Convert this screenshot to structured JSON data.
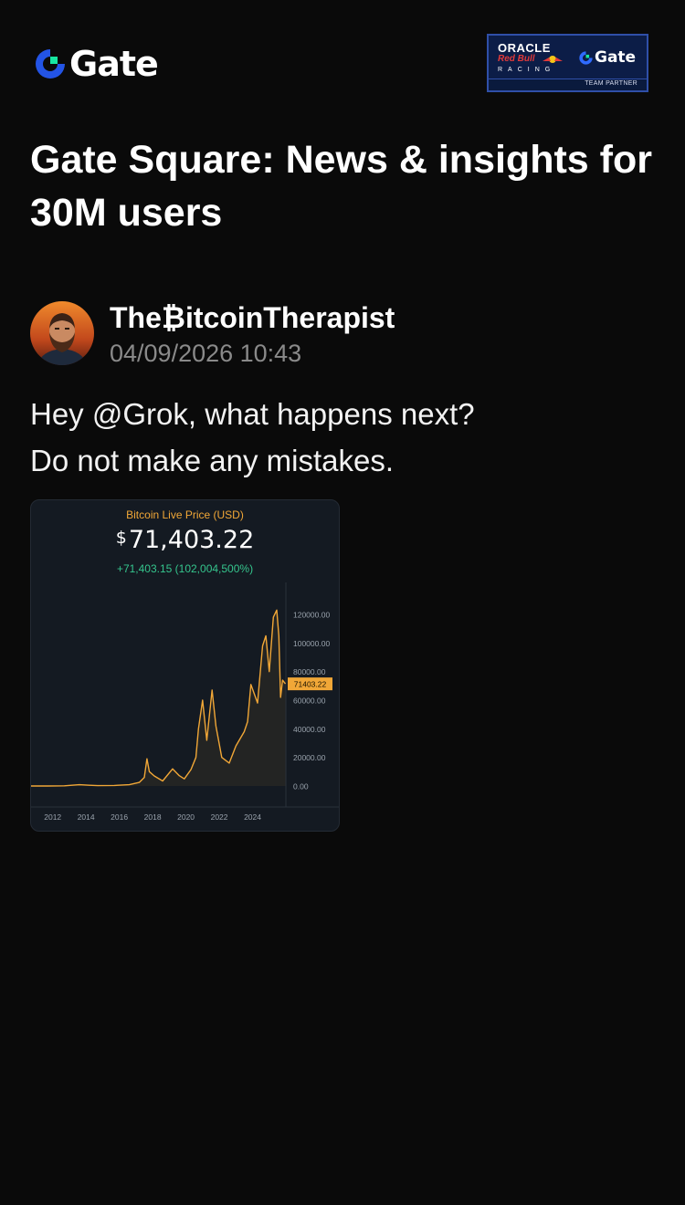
{
  "header": {
    "brand": "Gate",
    "partner_badge": {
      "oracle": "ORACLE",
      "redbull": "Red Bull",
      "racing": "RACING",
      "gate": "Gate",
      "footer": "TEAM PARTNER"
    }
  },
  "headline": "Gate Square: News & insights for 30M users",
  "post": {
    "author_name": "The₿itcoinTherapist",
    "timestamp": "04/09/2026 10:43",
    "lines": [
      "Hey @Grok, what happens next?",
      "Do not make any mistakes."
    ]
  },
  "chart_card": {
    "title": "Bitcoin Live Price (USD)",
    "price_symbol": "$",
    "price": "71,403.22",
    "change": "+71,403.15 (102,004,500%)",
    "current_label": "71403.22"
  },
  "colors": {
    "background": "#0a0a0a",
    "gate_blue": "#2354e6",
    "gate_cyan": "#17e6a1",
    "chart_line": "#f1a737",
    "positive": "#35c58d"
  },
  "chart_data": {
    "type": "line",
    "title": "Bitcoin Live Price (USD)",
    "xlabel": "",
    "ylabel": "",
    "x_ticks": [
      "2012",
      "2014",
      "2016",
      "2018",
      "2020",
      "2022",
      "2024"
    ],
    "y_ticks": [
      "0.00",
      "20000.00",
      "40000.00",
      "60000.00",
      "80000.00",
      "100000.00",
      "120000.00"
    ],
    "ylim": [
      0,
      120000
    ],
    "xlim": [
      2011.0,
      2026.3
    ],
    "grid": false,
    "series": [
      {
        "values": [
          [
            2011.0,
            5
          ],
          [
            2012.0,
            10
          ],
          [
            2013.0,
            120
          ],
          [
            2013.9,
            900
          ],
          [
            2014.5,
            500
          ],
          [
            2015.0,
            250
          ],
          [
            2016.0,
            400
          ],
          [
            2016.9,
            900
          ],
          [
            2017.5,
            2500
          ],
          [
            2017.8,
            6000
          ],
          [
            2017.96,
            19000
          ],
          [
            2018.1,
            10000
          ],
          [
            2018.4,
            7000
          ],
          [
            2018.9,
            3500
          ],
          [
            2019.5,
            12000
          ],
          [
            2019.9,
            7200
          ],
          [
            2020.2,
            5000
          ],
          [
            2020.6,
            11500
          ],
          [
            2020.9,
            20000
          ],
          [
            2021.05,
            40000
          ],
          [
            2021.3,
            60000
          ],
          [
            2021.55,
            32000
          ],
          [
            2021.87,
            67000
          ],
          [
            2022.1,
            42000
          ],
          [
            2022.45,
            20000
          ],
          [
            2022.9,
            16000
          ],
          [
            2023.3,
            28000
          ],
          [
            2023.8,
            38000
          ],
          [
            2024.0,
            45000
          ],
          [
            2024.2,
            71000
          ],
          [
            2024.6,
            58000
          ],
          [
            2024.9,
            98000
          ],
          [
            2025.1,
            105000
          ],
          [
            2025.3,
            80000
          ],
          [
            2025.55,
            118000
          ],
          [
            2025.75,
            123000
          ],
          [
            2025.88,
            105000
          ],
          [
            2025.98,
            62000
          ],
          [
            2026.1,
            74000
          ],
          [
            2026.27,
            71403.22
          ]
        ]
      }
    ]
  }
}
